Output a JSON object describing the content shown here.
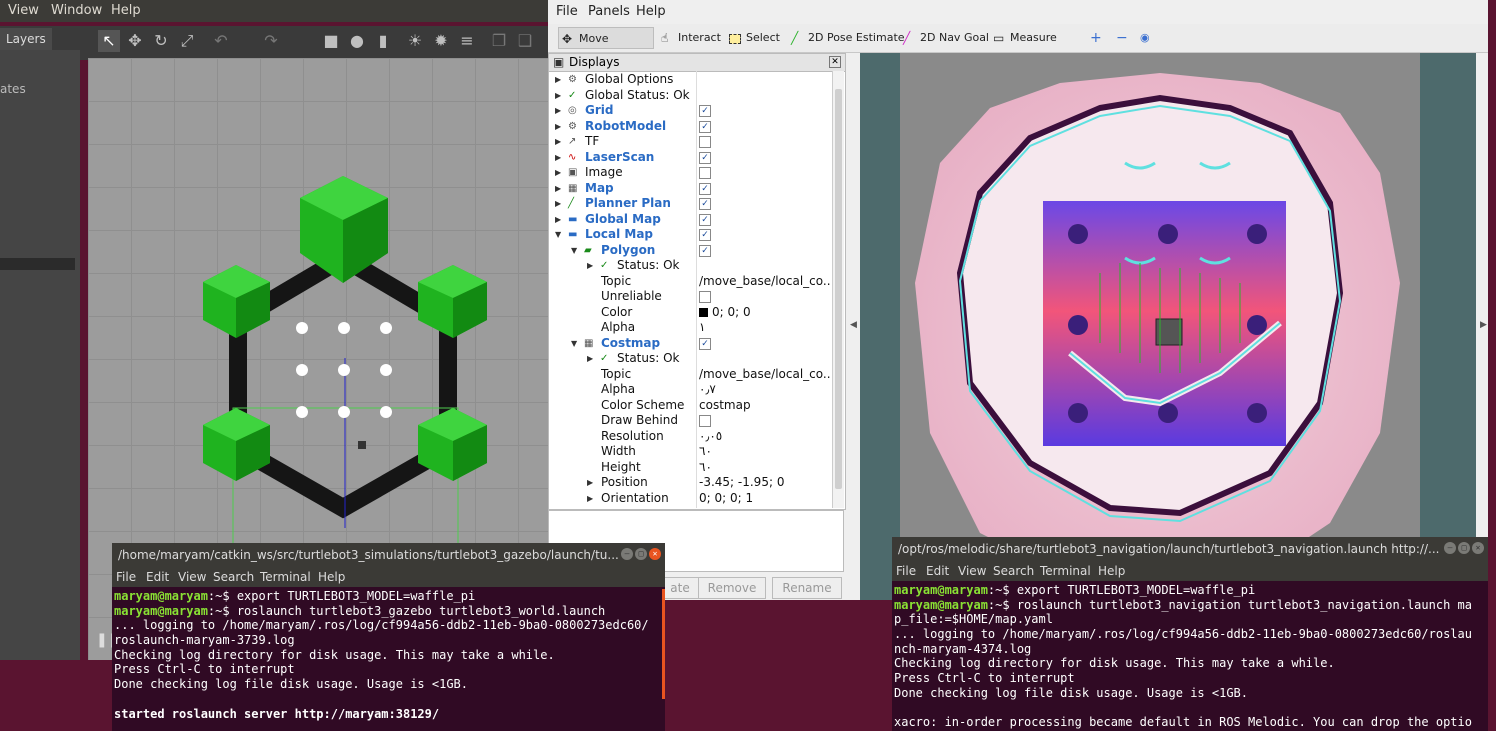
{
  "gazebo": {
    "menu": [
      "View",
      "Window",
      "Help"
    ],
    "layers_tab": "Layers",
    "left_partial": "ates"
  },
  "rviz": {
    "menu": [
      "File",
      "Panels",
      "Help"
    ],
    "tools": [
      "Move Camera",
      "Interact",
      "Select",
      "2D Pose Estimate",
      "2D Nav Goal",
      "Measure"
    ],
    "displays_title": "Displays",
    "rows": [
      {
        "label": "Global Options",
        "value": ""
      },
      {
        "label": "Global Status: Ok",
        "value": ""
      },
      {
        "label": "Grid",
        "value": ""
      },
      {
        "label": "RobotModel",
        "value": ""
      },
      {
        "label": "TF",
        "value": ""
      },
      {
        "label": "LaserScan",
        "value": ""
      },
      {
        "label": "Image",
        "value": ""
      },
      {
        "label": "Map",
        "value": ""
      },
      {
        "label": "Planner Plan",
        "value": ""
      },
      {
        "label": "Global Map",
        "value": ""
      },
      {
        "label": "Local Map",
        "value": ""
      },
      {
        "label": "Polygon",
        "value": ""
      },
      {
        "label": "Status: Ok",
        "value": ""
      },
      {
        "label": "Topic",
        "value": "/move_base/local_co..."
      },
      {
        "label": "Unreliable",
        "value": ""
      },
      {
        "label": "Color",
        "value": "0; 0; 0"
      },
      {
        "label": "Alpha",
        "value": "١"
      },
      {
        "label": "Costmap",
        "value": ""
      },
      {
        "label": "Status: Ok",
        "value": ""
      },
      {
        "label": "Topic",
        "value": "/move_base/local_co..."
      },
      {
        "label": "Alpha",
        "value": "٠٫٧"
      },
      {
        "label": "Color Scheme",
        "value": "costmap"
      },
      {
        "label": "Draw Behind",
        "value": ""
      },
      {
        "label": "Resolution",
        "value": "٠٫٠٥"
      },
      {
        "label": "Width",
        "value": "٦٠"
      },
      {
        "label": "Height",
        "value": "٦٠"
      },
      {
        "label": "Position",
        "value": "-3.45; -1.95; 0"
      },
      {
        "label": "Orientation",
        "value": "0; 0; 0; 1"
      }
    ],
    "buttons": {
      "add_partial": "ate",
      "remove": "Remove",
      "rename": "Rename"
    }
  },
  "term1": {
    "title": "/home/maryam/catkin_ws/src/turtlebot3_simulations/turtlebot3_gazebo/launch/tu...",
    "menu": [
      "File",
      "Edit",
      "View",
      "Search",
      "Terminal",
      "Help"
    ],
    "prompt1": "maryam@maryam",
    "cmd1": ":~$ export TURTLEBOT3_MODEL=waffle_pi",
    "prompt2": "maryam@maryam",
    "cmd2": ":~$ roslaunch turtlebot3_gazebo turtlebot3_world.launch",
    "lines": [
      "... logging to /home/maryam/.ros/log/cf994a56-ddb2-11eb-9ba0-0800273edc60/",
      "roslaunch-maryam-3739.log",
      "Checking log directory for disk usage. This may take a while.",
      "Press Ctrl-C to interrupt",
      "Done checking log file disk usage. Usage is <1GB.",
      "",
      "started roslaunch server http://maryam:38129/"
    ]
  },
  "term2": {
    "title": "/opt/ros/melodic/share/turtlebot3_navigation/launch/turtlebot3_navigation.launch http://...",
    "menu": [
      "File",
      "Edit",
      "View",
      "Search",
      "Terminal",
      "Help"
    ],
    "prompt1": "maryam@maryam",
    "cmd1": ":~$ export TURTLEBOT3_MODEL=waffle_pi",
    "prompt2": "maryam@maryam",
    "cmd2": ":~$ roslaunch turtlebot3_navigation turtlebot3_navigation.launch ma",
    "lines": [
      "p_file:=$HOME/map.yaml",
      "... logging to /home/maryam/.ros/log/cf994a56-ddb2-11eb-9ba0-0800273edc60/roslau",
      "nch-maryam-4374.log",
      "Checking log directory for disk usage. This may take a while.",
      "Press Ctrl-C to interrupt",
      "Done checking log file disk usage. Usage is <1GB.",
      "",
      "xacro: in-order processing became default in ROS Melodic. You can drop the optio"
    ]
  }
}
